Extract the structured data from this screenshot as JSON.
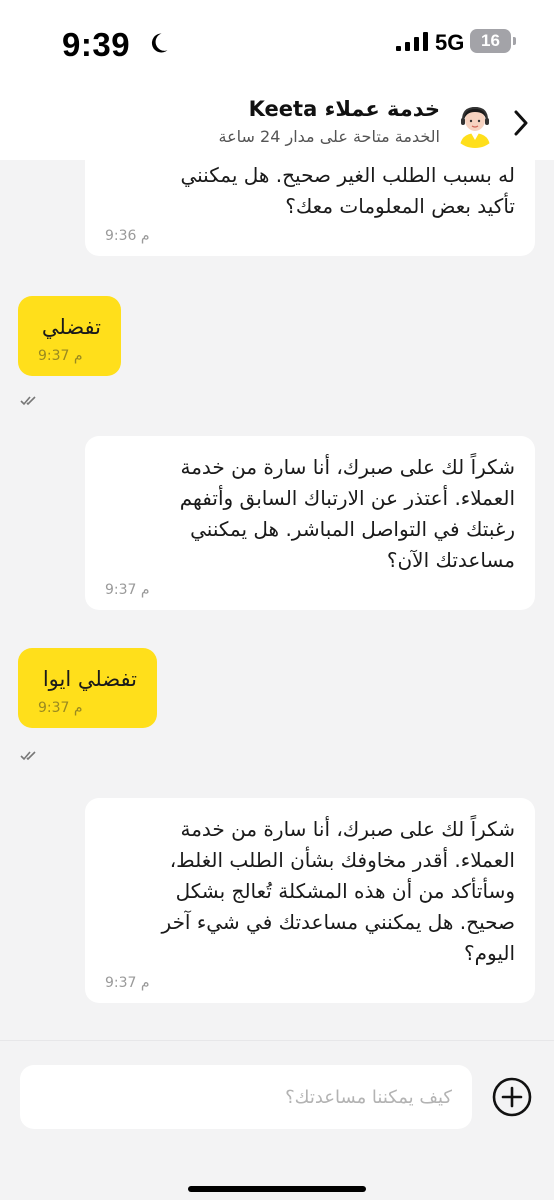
{
  "status_bar": {
    "time": "9:39",
    "network": "5G",
    "battery": "16"
  },
  "header": {
    "title": "خدمة عملاء Keeta",
    "subtitle": "الخدمة متاحة على مدار 24 ساعة"
  },
  "messages": [
    {
      "sender": "agent",
      "text": "له بسبب الطلب الغير صحيح. هل يمكنني\nتأكيد بعض المعلومات معك؟",
      "time": "9:36 م"
    },
    {
      "sender": "user",
      "text": "تفضلي",
      "time": "9:37 م"
    },
    {
      "sender": "agent",
      "text": "شكراً لك على صبرك، أنا سارة من خدمة\nالعملاء. أعتذر عن الارتباك السابق وأتفهم\nرغبتك في التواصل المباشر. هل يمكنني\nمساعدتك الآن؟",
      "time": "9:37 م"
    },
    {
      "sender": "user",
      "text": "تفضلي ايوا",
      "time": "9:37 م"
    },
    {
      "sender": "agent",
      "text": "شكراً لك على صبرك، أنا سارة من خدمة\nالعملاء. أقدر مخاوفك بشأن الطلب الغلط،\nوسأتأكد من أن هذه المشكلة تُعالج بشكل\nصحيح. هل يمكنني مساعدتك في شيء آخر\nاليوم؟",
      "time": "9:37 م"
    }
  ],
  "input": {
    "placeholder": "كيف يمكننا مساعدتك؟"
  },
  "colors": {
    "accent": "#ffdf1b",
    "background": "#f3f3f4",
    "agent_bubble": "#ffffff"
  },
  "icons": {
    "back": "chevron-right-icon",
    "add": "plus-circle-icon",
    "read": "double-check-icon"
  }
}
